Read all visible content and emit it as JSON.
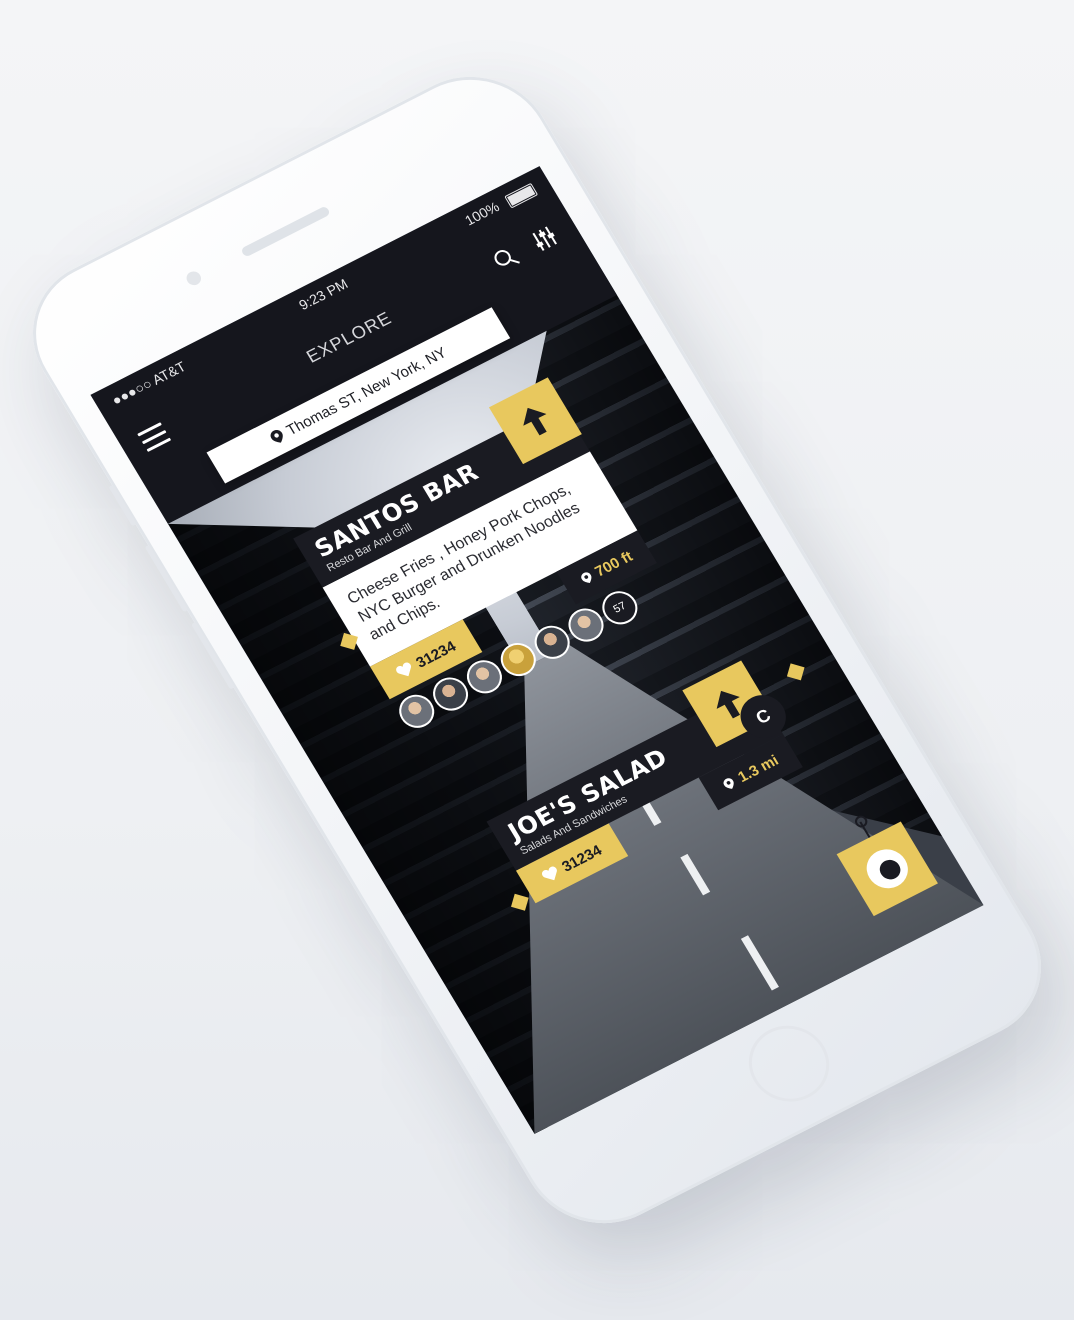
{
  "status": {
    "carrier": "●●●○○ AT&T",
    "time": "9:23 PM",
    "battery": "100%"
  },
  "header": {
    "title": "EXPLORE"
  },
  "location": {
    "text": "Thomas ST, New York, NY"
  },
  "cards": [
    {
      "name": "SANTOS BAR",
      "subtitle": "Resto Bar And Grill",
      "description": "Cheese Fries , Honey Pork Chops, NYC Burger and Drunken Noodles and Chips.",
      "likes": "31234",
      "distance": "700 ft",
      "avatar_count": "57"
    },
    {
      "name": "JOE'S SALAD",
      "subtitle": "Salads And Sandwiches",
      "likes": "31234",
      "distance": "1.3 mi"
    }
  ],
  "map_badge": "C",
  "colors": {
    "accent": "#e8c85e",
    "dark": "#1a1b22",
    "white": "#ffffff"
  },
  "icons": [
    "menu-icon",
    "search-icon",
    "filter-icon",
    "pin-icon",
    "heart-icon",
    "arrow-up-icon",
    "camera-eye-icon",
    "battery-icon",
    "wifi-icon"
  ]
}
